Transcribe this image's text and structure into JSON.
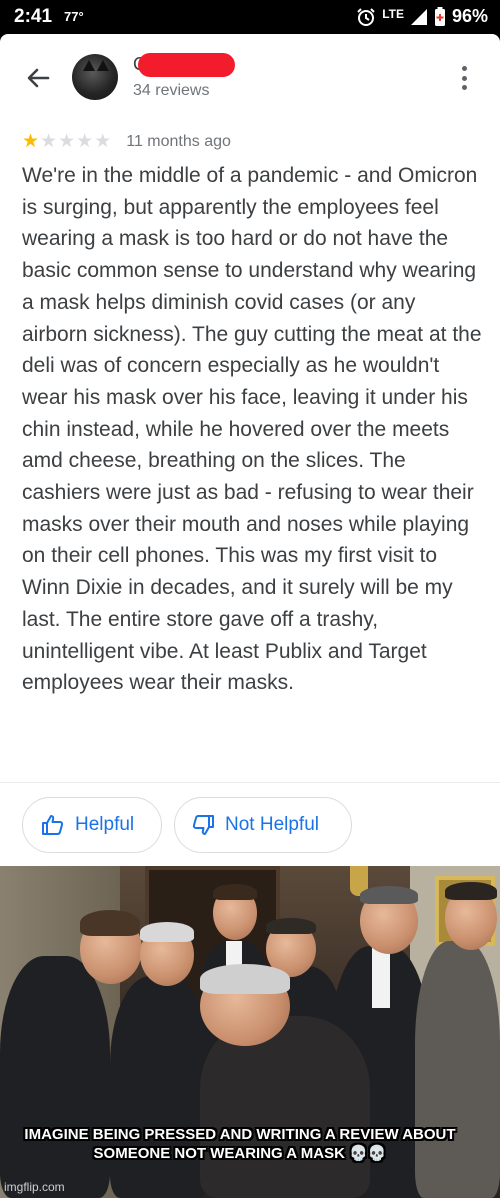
{
  "status_bar": {
    "time": "2:41",
    "temperature": "77°",
    "network": "LTE",
    "battery": "96%",
    "icons": [
      "alarm-icon",
      "signal-icon",
      "battery-icon"
    ]
  },
  "header": {
    "reviewer_name": "C",
    "review_count": "34 reviews",
    "icons": [
      "back-arrow-icon",
      "avatar",
      "more-vert-icon"
    ]
  },
  "review": {
    "rating": 1,
    "max_rating": 5,
    "time_ago": "11 months ago",
    "text": "We're in the middle of a pandemic - and Omicron is surging, but apparently the employees feel wearing a mask is too hard or do not have the basic common sense to understand why wearing a mask helps diminish covid cases (or any airborn sickness). The guy cutting the meat at the deli was of concern especially as he wouldn't wear his mask over his face, leaving it under his chin instead, while he hovered over the meets amd cheese, breathing on the slices. The cashiers were just as bad - refusing to wear their masks over their mouth and noses while playing on their cell phones. This was my first visit to Winn Dixie in decades, and it surely will be my last. The entire store gave off a trashy, unintelligent vibe. At least Publix and Target employees wear their masks."
  },
  "actions": {
    "helpful_label": "Helpful",
    "not_helpful_label": "Not Helpful"
  },
  "colors": {
    "accent": "#1a73e8",
    "star_on": "#fbbc04",
    "star_off": "#dadce0",
    "redaction": "#f21c2c"
  },
  "meme": {
    "caption": "IMAGINE BEING PRESSED AND WRITING A REVIEW ABOUT SOMEONE NOT WEARING A MASK 💀💀",
    "watermark": "imgflip.com"
  }
}
